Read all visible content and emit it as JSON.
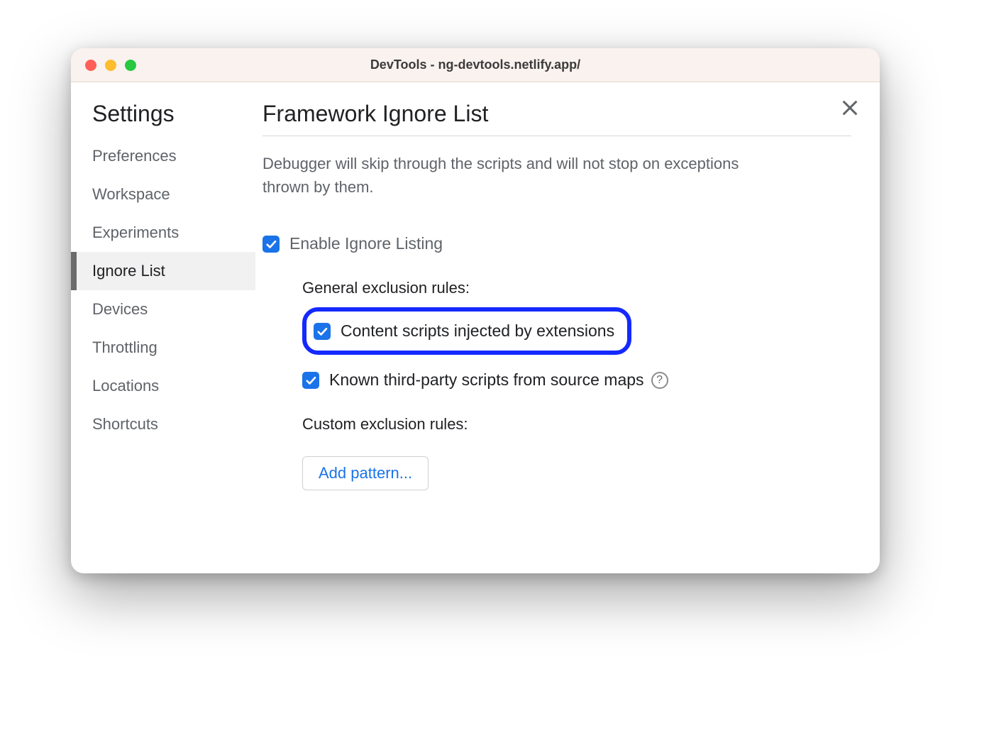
{
  "window": {
    "title": "DevTools - ng-devtools.netlify.app/"
  },
  "sidebar": {
    "title": "Settings",
    "items": [
      {
        "label": "Preferences",
        "active": false
      },
      {
        "label": "Workspace",
        "active": false
      },
      {
        "label": "Experiments",
        "active": false
      },
      {
        "label": "Ignore List",
        "active": true
      },
      {
        "label": "Devices",
        "active": false
      },
      {
        "label": "Throttling",
        "active": false
      },
      {
        "label": "Locations",
        "active": false
      },
      {
        "label": "Shortcuts",
        "active": false
      }
    ]
  },
  "main": {
    "page_title": "Framework Ignore List",
    "description": "Debugger will skip through the scripts and will not stop on exceptions thrown by them.",
    "enable_label": "Enable Ignore Listing",
    "enable_checked": true,
    "general_heading": "General exclusion rules:",
    "rules": [
      {
        "label": "Content scripts injected by extensions",
        "checked": true,
        "highlighted": true,
        "help": false
      },
      {
        "label": "Known third-party scripts from source maps",
        "checked": true,
        "highlighted": false,
        "help": true
      }
    ],
    "custom_heading": "Custom exclusion rules:",
    "add_pattern_label": "Add pattern...",
    "help_glyph": "?"
  },
  "colors": {
    "accent": "#1a73e8",
    "highlight_border": "#1429ff"
  }
}
